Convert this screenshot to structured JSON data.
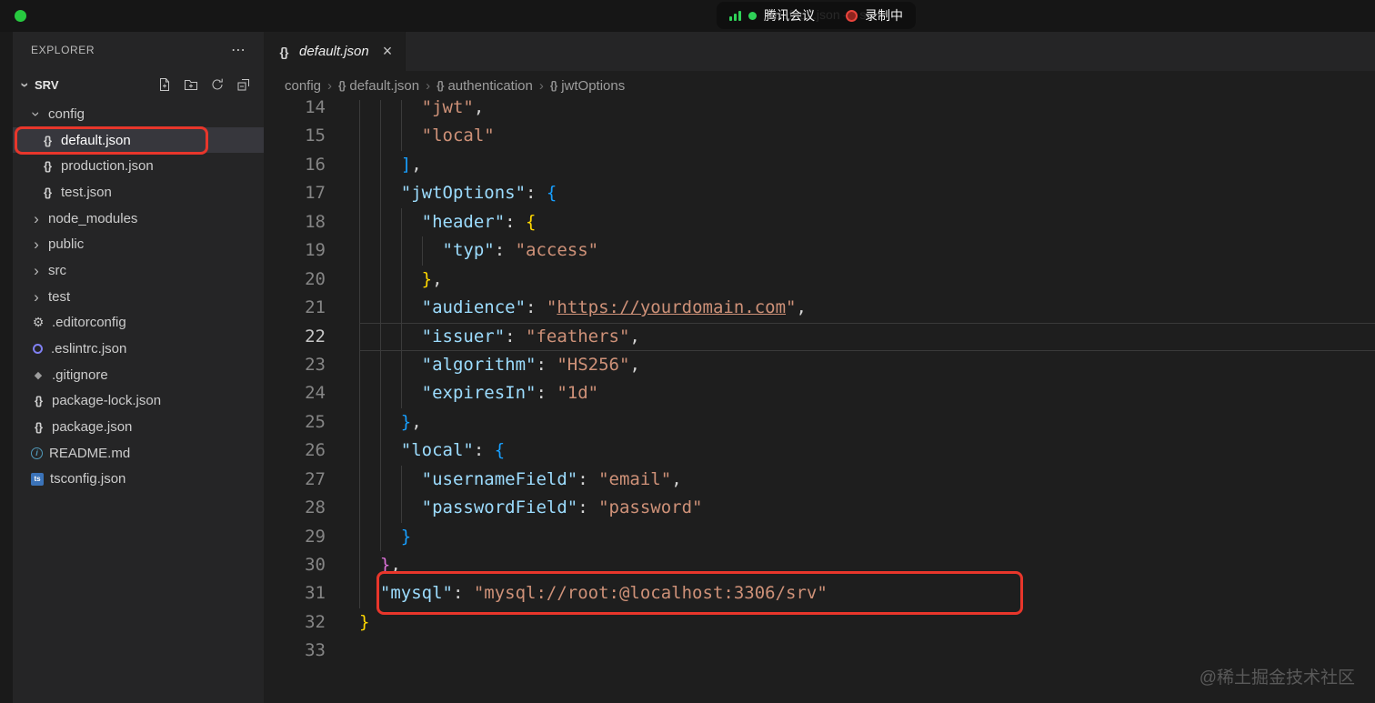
{
  "titlebar": {
    "window_title": "default.json — srv",
    "meeting_app": "腾讯会议",
    "recording_label": "录制中",
    "icons": [
      "signal-bars-icon",
      "green-status-dot",
      "record-icon",
      "window-control-green"
    ]
  },
  "explorer": {
    "title": "EXPLORER",
    "more_label": "⋯",
    "section_label": "SRV",
    "action_icons": [
      "new-file-icon",
      "new-folder-icon",
      "refresh-icon",
      "collapse-all-icon"
    ],
    "items": [
      {
        "label": "config",
        "icon": "folder-chevron",
        "indent": 0,
        "expanded": true
      },
      {
        "label": "default.json",
        "icon": "json",
        "indent": 1,
        "selected": true
      },
      {
        "label": "production.json",
        "icon": "json",
        "indent": 1
      },
      {
        "label": "test.json",
        "icon": "json",
        "indent": 1
      },
      {
        "label": "node_modules",
        "icon": "folder-chevron",
        "indent": 0
      },
      {
        "label": "public",
        "icon": "folder-chevron",
        "indent": 0
      },
      {
        "label": "src",
        "icon": "folder-chevron",
        "indent": 0
      },
      {
        "label": "test",
        "icon": "folder-chevron",
        "indent": 0
      },
      {
        "label": ".editorconfig",
        "icon": "gear",
        "indent": 0
      },
      {
        "label": ".eslintrc.json",
        "icon": "eslint",
        "indent": 0
      },
      {
        "label": ".gitignore",
        "icon": "git-diamond",
        "indent": 0
      },
      {
        "label": "package-lock.json",
        "icon": "json",
        "indent": 0
      },
      {
        "label": "package.json",
        "icon": "json",
        "indent": 0
      },
      {
        "label": "README.md",
        "icon": "info",
        "indent": 0
      },
      {
        "label": "tsconfig.json",
        "icon": "ts",
        "indent": 0
      }
    ]
  },
  "editor": {
    "tab": {
      "label": "default.json",
      "icon_glyph": "{}",
      "close_glyph": "×"
    },
    "breadcrumb": [
      {
        "label": "config",
        "icon": false
      },
      {
        "label": "default.json",
        "icon": true
      },
      {
        "label": "authentication",
        "icon": true
      },
      {
        "label": "jwtOptions",
        "icon": true
      }
    ],
    "lines": [
      {
        "num": 14,
        "indent": 6,
        "tokens": [
          {
            "c": "str",
            "t": "\"jwt\""
          },
          {
            "c": "punct",
            "t": ","
          }
        ]
      },
      {
        "num": 15,
        "indent": 6,
        "tokens": [
          {
            "c": "str",
            "t": "\"local\""
          }
        ]
      },
      {
        "num": 16,
        "indent": 4,
        "tokens": [
          {
            "c": "b3",
            "t": "]"
          },
          {
            "c": "punct",
            "t": ","
          }
        ]
      },
      {
        "num": 17,
        "indent": 4,
        "tokens": [
          {
            "c": "key",
            "t": "\"jwtOptions\""
          },
          {
            "c": "punct",
            "t": ": "
          },
          {
            "c": "b3",
            "t": "{"
          }
        ]
      },
      {
        "num": 18,
        "indent": 6,
        "tokens": [
          {
            "c": "key",
            "t": "\"header\""
          },
          {
            "c": "punct",
            "t": ": "
          },
          {
            "c": "b1",
            "t": "{"
          }
        ]
      },
      {
        "num": 19,
        "indent": 8,
        "tokens": [
          {
            "c": "key",
            "t": "\"typ\""
          },
          {
            "c": "punct",
            "t": ": "
          },
          {
            "c": "str",
            "t": "\"access\""
          }
        ]
      },
      {
        "num": 20,
        "indent": 6,
        "tokens": [
          {
            "c": "b1",
            "t": "}"
          },
          {
            "c": "punct",
            "t": ","
          }
        ]
      },
      {
        "num": 21,
        "indent": 6,
        "tokens": [
          {
            "c": "key",
            "t": "\"audience\""
          },
          {
            "c": "punct",
            "t": ": "
          },
          {
            "c": "str",
            "t": "\""
          },
          {
            "c": "link",
            "t": "https://yourdomain.com"
          },
          {
            "c": "str",
            "t": "\""
          },
          {
            "c": "punct",
            "t": ","
          }
        ]
      },
      {
        "num": 22,
        "indent": 6,
        "current": true,
        "tokens": [
          {
            "c": "key",
            "t": "\"issuer\""
          },
          {
            "c": "punct",
            "t": ": "
          },
          {
            "c": "str",
            "t": "\"feathers\""
          },
          {
            "c": "punct",
            "t": ","
          }
        ]
      },
      {
        "num": 23,
        "indent": 6,
        "tokens": [
          {
            "c": "key",
            "t": "\"algorithm\""
          },
          {
            "c": "punct",
            "t": ": "
          },
          {
            "c": "str",
            "t": "\"HS256\""
          },
          {
            "c": "punct",
            "t": ","
          }
        ]
      },
      {
        "num": 24,
        "indent": 6,
        "tokens": [
          {
            "c": "key",
            "t": "\"expiresIn\""
          },
          {
            "c": "punct",
            "t": ": "
          },
          {
            "c": "str",
            "t": "\"1d\""
          }
        ]
      },
      {
        "num": 25,
        "indent": 4,
        "tokens": [
          {
            "c": "b3",
            "t": "}"
          },
          {
            "c": "punct",
            "t": ","
          }
        ]
      },
      {
        "num": 26,
        "indent": 4,
        "tokens": [
          {
            "c": "key",
            "t": "\"local\""
          },
          {
            "c": "punct",
            "t": ": "
          },
          {
            "c": "b3",
            "t": "{"
          }
        ]
      },
      {
        "num": 27,
        "indent": 6,
        "tokens": [
          {
            "c": "key",
            "t": "\"usernameField\""
          },
          {
            "c": "punct",
            "t": ": "
          },
          {
            "c": "str",
            "t": "\"email\""
          },
          {
            "c": "punct",
            "t": ","
          }
        ]
      },
      {
        "num": 28,
        "indent": 6,
        "tokens": [
          {
            "c": "key",
            "t": "\"passwordField\""
          },
          {
            "c": "punct",
            "t": ": "
          },
          {
            "c": "str",
            "t": "\"password\""
          }
        ]
      },
      {
        "num": 29,
        "indent": 4,
        "tokens": [
          {
            "c": "b3",
            "t": "}"
          }
        ]
      },
      {
        "num": 30,
        "indent": 2,
        "tokens": [
          {
            "c": "b2",
            "t": "}"
          },
          {
            "c": "punct",
            "t": ","
          }
        ]
      },
      {
        "num": 31,
        "indent": 2,
        "tokens": [
          {
            "c": "key",
            "t": "\"mysql\""
          },
          {
            "c": "punct",
            "t": ": "
          },
          {
            "c": "str",
            "t": "\"mysql://root:@localhost:3306/srv\""
          }
        ]
      },
      {
        "num": 32,
        "indent": 0,
        "tokens": [
          {
            "c": "b1",
            "t": "}"
          }
        ]
      },
      {
        "num": 33,
        "indent": 0,
        "tokens": []
      }
    ]
  },
  "watermark": "@稀土掘金技术社区",
  "colors": {
    "editor_bg": "#1e1e1e",
    "sidebar_bg": "#252526",
    "titlebar_bg": "#161616",
    "selected_row": "#37373d",
    "syntax_key": "#9cdcfe",
    "syntax_string": "#ce9178",
    "syntax_punct": "#d4d4d4",
    "bracket_gold": "#ffd700",
    "bracket_pink": "#da70d6",
    "bracket_blue": "#179fff",
    "line_number": "#858585",
    "signal_green": "#2fd158",
    "record_red": "#e8443c",
    "annotation_red": "#e8362b"
  }
}
